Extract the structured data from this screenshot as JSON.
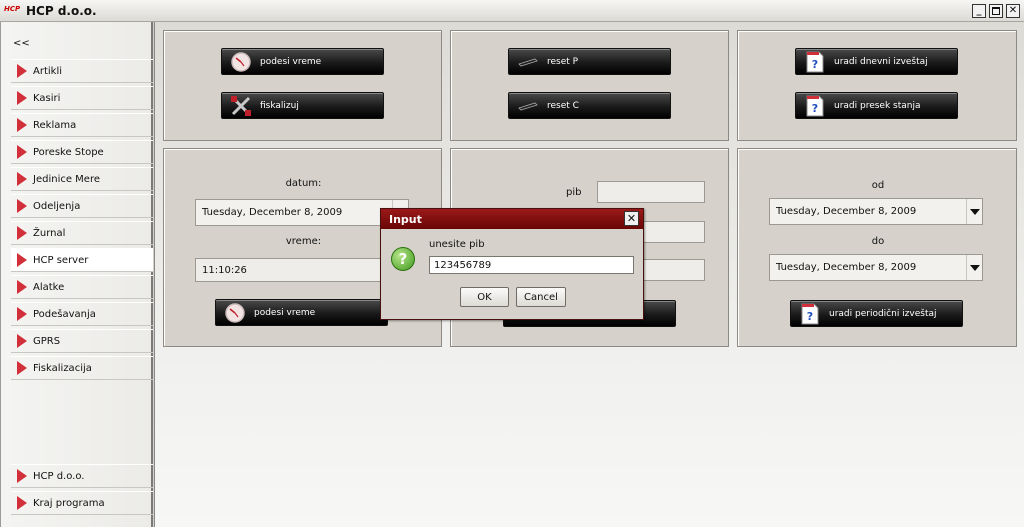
{
  "window": {
    "logo_text": "HCP",
    "title": "HCP d.o.o."
  },
  "sidebar": {
    "collapse_label": "<<",
    "items": [
      {
        "label": "Artikli"
      },
      {
        "label": "Kasiri"
      },
      {
        "label": "Reklama"
      },
      {
        "label": "Poreske Stope"
      },
      {
        "label": "Jedinice Mere"
      },
      {
        "label": "Odeljenja"
      },
      {
        "label": "Žurnal"
      },
      {
        "label": "HCP server"
      },
      {
        "label": "Alatke"
      },
      {
        "label": "Podešavanja"
      },
      {
        "label": "GPRS"
      },
      {
        "label": "Fiskalizacija"
      }
    ],
    "active_item": "HCP server",
    "footer_items": [
      {
        "label": "HCP d.o.o."
      },
      {
        "label": "Kraj programa"
      }
    ]
  },
  "panel1": {
    "set_time_label": "podesi vreme",
    "fiscalize_label": "fiskalizuj"
  },
  "panel2": {
    "reset_p_label": "reset P",
    "reset_c_label": "reset C"
  },
  "panel3": {
    "daily_report_label": "uradi dnevni izveštaj",
    "state_report_label": "uradi presek stanja"
  },
  "panel4": {
    "date_label": "datum:",
    "date_value": "Tuesday, December 8, 2009",
    "time_label": "vreme:",
    "time_value": "11:10:26",
    "set_time_label": "podesi vreme"
  },
  "panel5": {
    "pib_label": "pib"
  },
  "panel6": {
    "from_label": "od",
    "from_value": "Tuesday, December 8, 2009",
    "to_label": "do",
    "to_value": "Tuesday, December 8, 2009",
    "periodic_report_label": "uradi periodični izveštaj"
  },
  "dialog": {
    "title": "Input",
    "message": "unesite pib",
    "input_value": "123456789",
    "ok_label": "OK",
    "cancel_label": "Cancel"
  },
  "colors": {
    "accent_red": "#d1303a",
    "dialog_title": "#8a1010",
    "button_dark": "#1a1a1a",
    "panel_bg": "#d6d2cb"
  }
}
